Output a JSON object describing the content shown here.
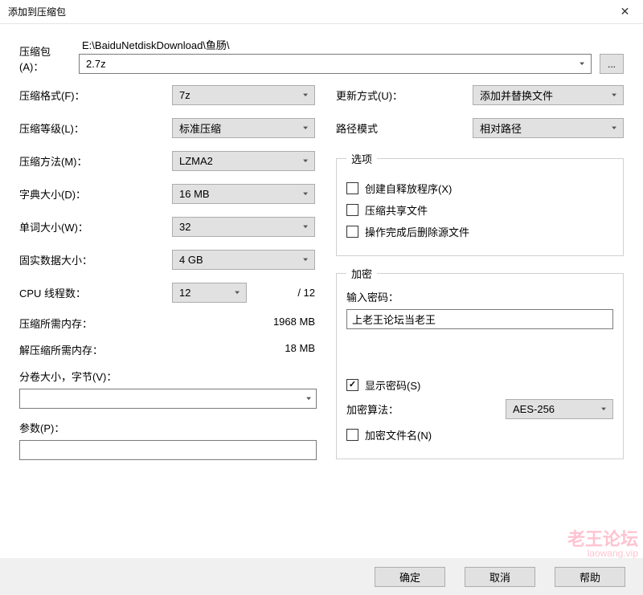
{
  "window": {
    "title": "添加到压缩包",
    "close": "✕"
  },
  "archive": {
    "label": "压缩包(A)：",
    "path": "E:\\BaiduNetdiskDownload\\鱼肠\\",
    "file": "2.7z",
    "browse": "..."
  },
  "left": {
    "format": {
      "label": "压缩格式(F)：",
      "value": "7z"
    },
    "level": {
      "label": "压缩等级(L)：",
      "value": "标准压缩"
    },
    "method": {
      "label": "压缩方法(M)：",
      "value": "LZMA2"
    },
    "dict": {
      "label": "字典大小(D)：",
      "value": "16 MB"
    },
    "word": {
      "label": "单词大小(W)：",
      "value": "32"
    },
    "solid": {
      "label": "固实数据大小：",
      "value": "4 GB"
    },
    "threads": {
      "label": "CPU 线程数：",
      "value": "12",
      "total": "/ 12"
    },
    "mem_comp": {
      "label": "压缩所需内存：",
      "value": "1968 MB"
    },
    "mem_decomp": {
      "label": "解压缩所需内存：",
      "value": "18 MB"
    },
    "volume": {
      "label": "分卷大小，字节(V)："
    },
    "params": {
      "label": "参数(P)："
    }
  },
  "right": {
    "update": {
      "label": "更新方式(U)：",
      "value": "添加并替换文件"
    },
    "pathmode": {
      "label": "路径模式",
      "value": "相对路径"
    },
    "options": {
      "legend": "选项",
      "sfx": "创建自释放程序(X)",
      "shared": "压缩共享文件",
      "delete": "操作完成后删除源文件"
    },
    "encryption": {
      "legend": "加密",
      "pwd_label": "输入密码：",
      "pwd_value": "上老王论坛当老王",
      "show_pwd": "显示密码(S)",
      "method_label": "加密算法：",
      "method_value": "AES-256",
      "encrypt_names": "加密文件名(N)"
    }
  },
  "footer": {
    "ok": "确定",
    "cancel": "取消",
    "help": "帮助"
  },
  "watermark": {
    "main": "老王论坛",
    "sub": "laowang.vip"
  }
}
